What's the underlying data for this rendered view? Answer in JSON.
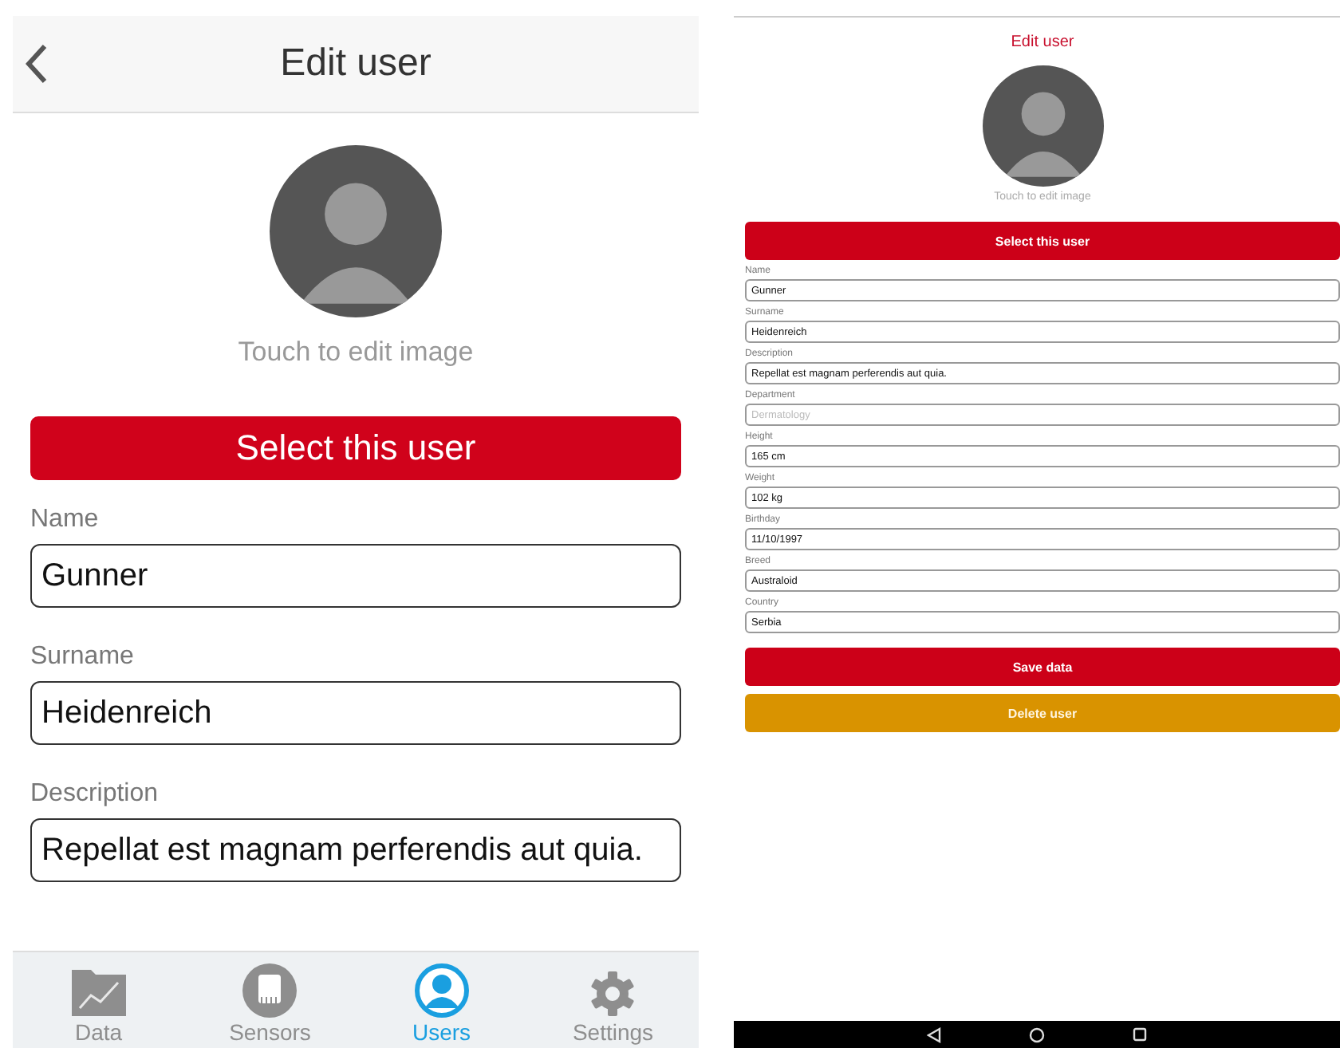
{
  "ios_screen": {
    "header": {
      "title": "Edit user"
    },
    "image_hint": "Touch to edit image",
    "select_button": "Select this user",
    "fields": [
      {
        "label": "Name",
        "value": "Gunner"
      },
      {
        "label": "Surname",
        "value": "Heidenreich"
      },
      {
        "label": "Description",
        "value": "Repellat est magnam perferendis aut quia."
      }
    ],
    "tabs": [
      {
        "label": "Data",
        "selected": false
      },
      {
        "label": "Sensors",
        "selected": false
      },
      {
        "label": "Users",
        "selected": true
      },
      {
        "label": "Settings",
        "selected": false
      }
    ]
  },
  "android_screen": {
    "title": "Edit user",
    "image_hint": "Touch to edit image",
    "select_button": "Select this user",
    "fields": [
      {
        "label": "Name",
        "value": "Gunner"
      },
      {
        "label": "Surname",
        "value": "Heidenreich"
      },
      {
        "label": "Description",
        "value": "Repellat est magnam perferendis aut quia."
      },
      {
        "label": "Department",
        "placeholder": "Dermatology"
      },
      {
        "label": "Height",
        "value": "165 cm"
      },
      {
        "label": "Weight",
        "value": "102 kg"
      },
      {
        "label": "Birthday",
        "value": "11/10/1997"
      },
      {
        "label": "Breed",
        "value": "Australoid"
      },
      {
        "label": "Country",
        "value": "Serbia"
      }
    ],
    "save_button": "Save data",
    "delete_button": "Delete user"
  }
}
